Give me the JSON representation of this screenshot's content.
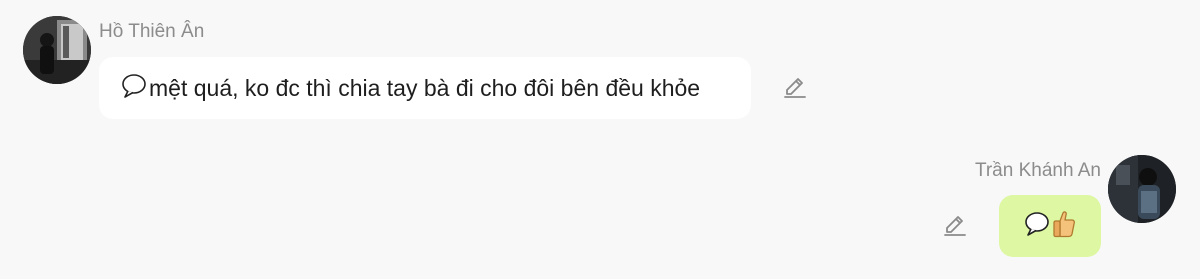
{
  "messages": [
    {
      "sender": "Hồ Thiên Ân",
      "side": "left",
      "text": "mệt quá, ko đc thì chia tay bà đi cho đôi bên đều khỏe",
      "bubble_color": "#ffffff",
      "icons": [
        "speech-balloon-icon",
        "edit-pencil-icon"
      ]
    },
    {
      "sender": "Trần Khánh An",
      "side": "right",
      "text": "",
      "bubble_color": "#ddf7a3",
      "icons": [
        "speech-balloon-icon",
        "thumbs-up-icon",
        "edit-pencil-icon"
      ]
    }
  ],
  "colors": {
    "background": "#f8f8f8",
    "sender_name": "#8c8c8c",
    "text": "#1e1e1e"
  }
}
